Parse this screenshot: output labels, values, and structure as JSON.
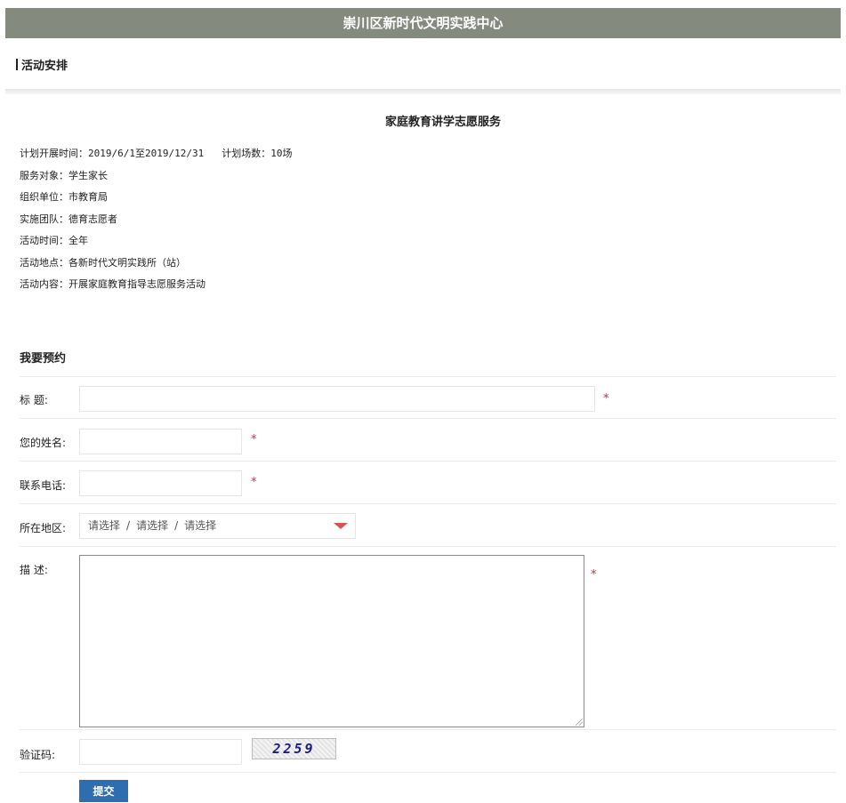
{
  "header": {
    "title": "崇川区新时代文明实践中心"
  },
  "section": {
    "title": "活动安排"
  },
  "activity": {
    "title": "家庭教育讲学志愿服务",
    "plan_time_label": "计划开展时间：",
    "plan_time_value": "2019/6/1至2019/12/31",
    "plan_count_label": "计划场数：",
    "plan_count_value": "10场",
    "target_label": "服务对象：",
    "target_value": "学生家长",
    "org_label": "组织单位：",
    "org_value": "市教育局",
    "team_label": "实施团队：",
    "team_value": "德育志愿者",
    "time_label": "活动时间：",
    "time_value": "全年",
    "place_label": "活动地点：",
    "place_value": "各新时代文明实践所（站）",
    "content_label": "活动内容：",
    "content_value": "开展家庭教育指导志愿服务活动"
  },
  "form": {
    "heading": "我要预约",
    "title_label": "标 题:",
    "name_label": "您的姓名:",
    "phone_label": "联系电话:",
    "region_label": "所在地区:",
    "region_values": [
      "请选择",
      "请选择",
      "请选择"
    ],
    "region_separator": "/",
    "desc_label": "描 述:",
    "captcha_label": "验证码:",
    "captcha_text": "2259",
    "required_mark": "*",
    "submit_label": "提交"
  },
  "colors": {
    "header_bg": "#848a7e",
    "required": "#d9272e",
    "button": "#2d6db0"
  }
}
